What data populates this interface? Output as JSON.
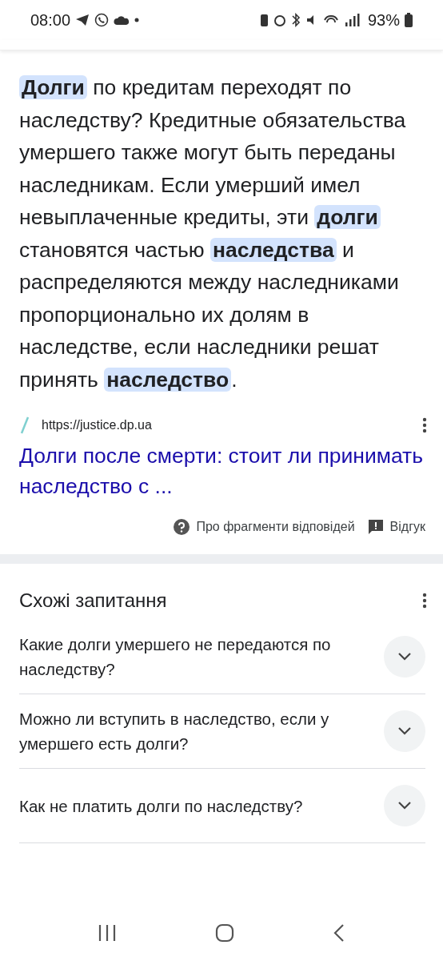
{
  "status_bar": {
    "time": "08:00",
    "battery": "93%"
  },
  "answer": {
    "segments": [
      {
        "text": "Долги",
        "highlighted": true
      },
      {
        "text": " по кредитам переходят по наследству? Кредитные обязательства умершего также могут быть переданы наследникам. Если умерший имел невыплаченные кредиты, эти ",
        "highlighted": false
      },
      {
        "text": "долги",
        "highlighted": true
      },
      {
        "text": " становятся частью ",
        "highlighted": false
      },
      {
        "text": "наследства",
        "highlighted": true
      },
      {
        "text": " и распределяются между наследниками пропорционально их долям в наследстве, если наследники решат принять ",
        "highlighted": false
      },
      {
        "text": "наследство",
        "highlighted": true
      },
      {
        "text": ".",
        "highlighted": false
      }
    ],
    "source_url": "https://justice.dp.ua",
    "link_title": "Долги после смерти: стоит ли принимать наследство с ...",
    "about_label": "Про фрагменти відповідей",
    "feedback_label": "Відгук"
  },
  "related": {
    "title": "Схожі запитання",
    "questions": [
      {
        "text": "Какие долги умершего не передаются по наследству?",
        "expanded": false
      },
      {
        "text": "Можно ли вступить в наследство, если у умершего есть долги?",
        "expanded": false
      },
      {
        "text": "Как не платить долги по наследству?",
        "expanded": false
      }
    ]
  }
}
